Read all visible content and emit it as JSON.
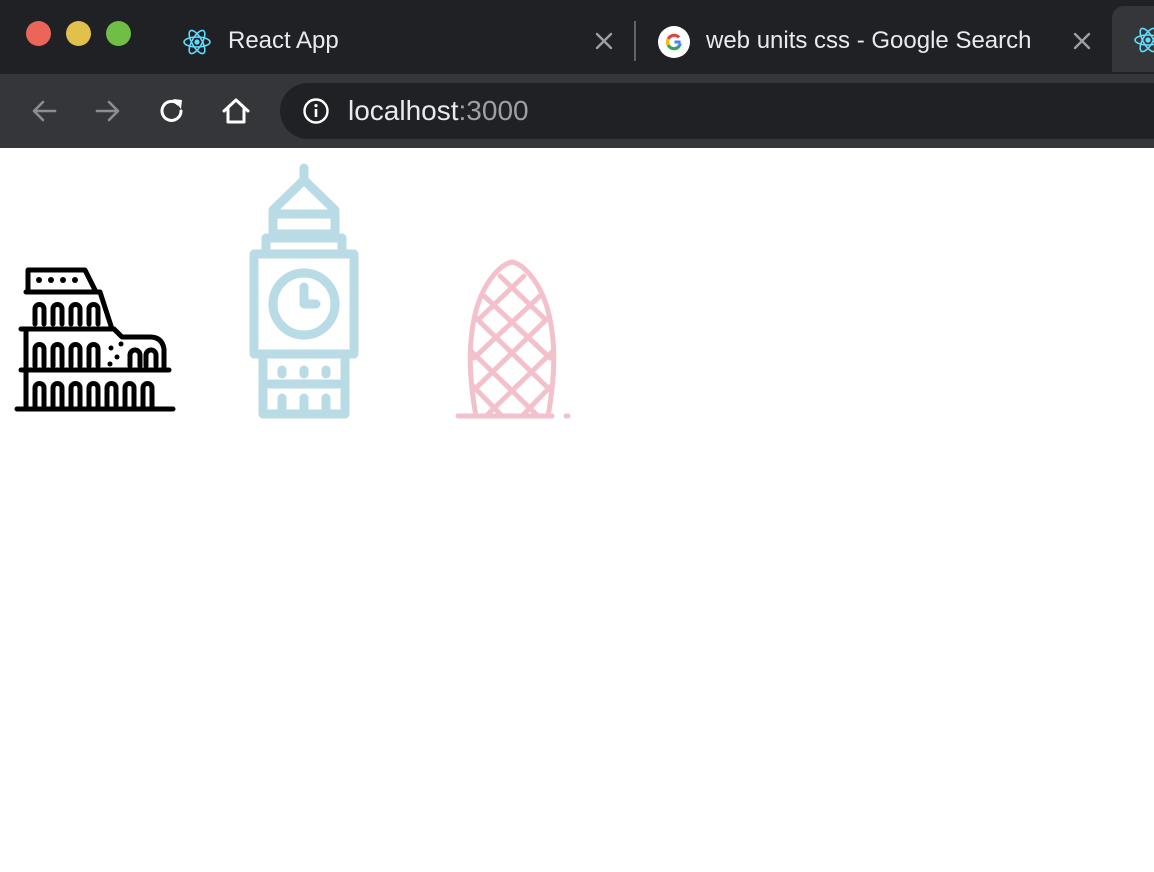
{
  "browser": {
    "tabs": [
      {
        "title": "React App",
        "favicon": "react-icon",
        "close_icon": "close-icon"
      },
      {
        "title": "web units css - Google Search",
        "favicon": "google-icon",
        "close_icon": "close-icon"
      },
      {
        "title": "",
        "favicon": "react-icon"
      }
    ],
    "toolbar": {
      "back_icon": "arrow-left-icon",
      "forward_icon": "arrow-right-icon",
      "reload_icon": "reload-icon",
      "home_icon": "home-icon"
    },
    "address_bar": {
      "info_icon": "info-icon",
      "host": "localhost",
      "port": ":3000"
    },
    "colors": {
      "traffic_close": "#ec6559",
      "traffic_min": "#e1c04c",
      "traffic_max": "#71be47",
      "react_blue": "#61dafb",
      "tabstrip_bg": "#202124",
      "toolbar_bg": "#35363a"
    }
  },
  "page": {
    "landmarks": [
      {
        "name": "colosseum",
        "icon": "colosseum-icon",
        "color": "#000000"
      },
      {
        "name": "big-ben",
        "icon": "big-ben-icon",
        "color": "#b8dbe6"
      },
      {
        "name": "gherkin",
        "icon": "gherkin-icon",
        "color": "#f3c1cb"
      }
    ]
  }
}
